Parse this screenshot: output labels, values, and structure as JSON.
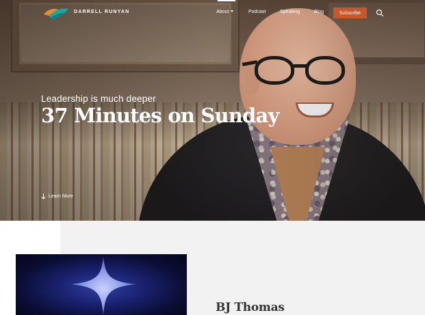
{
  "nav": {
    "brand": "DARRELL RUNYAN",
    "items": [
      {
        "label": "About",
        "has_dropdown": true
      },
      {
        "label": "Podcast"
      },
      {
        "label": "Speaking"
      },
      {
        "label": "Blog"
      }
    ],
    "subscribe_label": "Subscribe",
    "search_icon": "search-icon",
    "logo_icon": "bird-logo-icon",
    "accent_color": "#c9572c"
  },
  "hero": {
    "tagline": "Leadership is much deeper",
    "title": "37 Minutes on Sunday",
    "learn_more_label": "Learn More",
    "learn_more_icon": "arrow-down-icon"
  },
  "card": {
    "title": "BJ Thomas",
    "image_icon": "star-cross-icon"
  }
}
